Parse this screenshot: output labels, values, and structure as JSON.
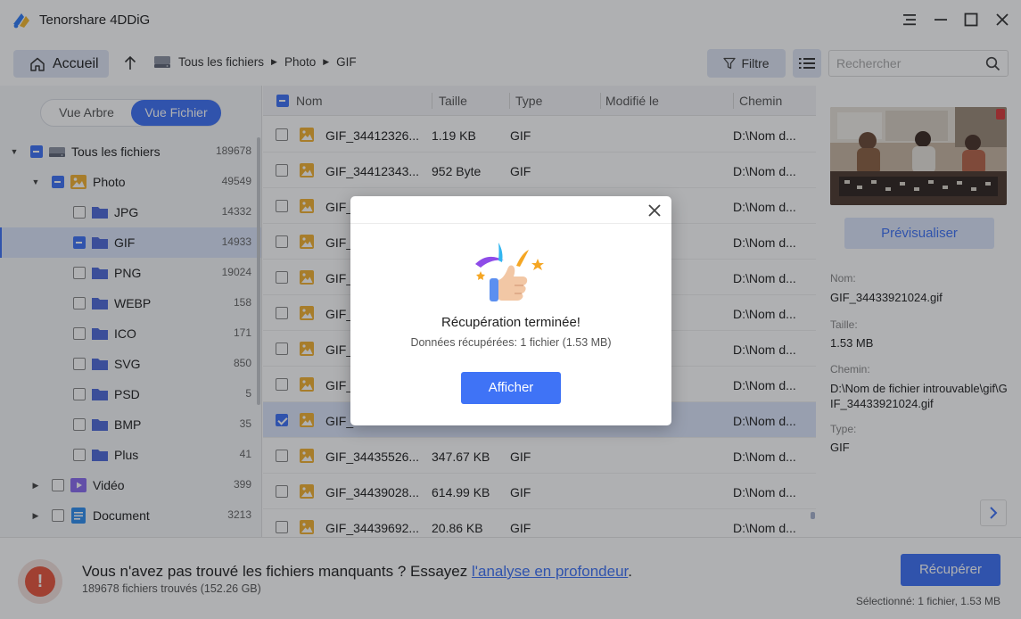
{
  "app": {
    "title": "Tenorshare 4DDiG"
  },
  "toolbar": {
    "home_label": "Accueil",
    "breadcrumb": [
      "Tous les fichiers",
      "Photo",
      "GIF"
    ],
    "filter_label": "Filtre",
    "search_placeholder": "Rechercher"
  },
  "sidebar": {
    "view_tree_label": "Vue Arbre",
    "view_file_label": "Vue Fichier",
    "tree": [
      {
        "label": "Tous les fichiers",
        "count": "189678"
      },
      {
        "label": "Photo",
        "count": "49549"
      },
      {
        "label": "JPG",
        "count": "14332"
      },
      {
        "label": "GIF",
        "count": "14933"
      },
      {
        "label": "PNG",
        "count": "19024"
      },
      {
        "label": "WEBP",
        "count": "158"
      },
      {
        "label": "ICO",
        "count": "171"
      },
      {
        "label": "SVG",
        "count": "850"
      },
      {
        "label": "PSD",
        "count": "5"
      },
      {
        "label": "BMP",
        "count": "35"
      },
      {
        "label": "Plus",
        "count": "41"
      },
      {
        "label": "Vidéo",
        "count": "399"
      },
      {
        "label": "Document",
        "count": "3213"
      }
    ]
  },
  "file_list": {
    "columns": [
      "Nom",
      "Taille",
      "Type",
      "Modifié le",
      "Chemin"
    ],
    "rows": [
      {
        "name": "GIF_34412326...",
        "size": "1.19 KB",
        "type": "GIF",
        "modified": "",
        "path": "D:\\Nom d..."
      },
      {
        "name": "GIF_34412343...",
        "size": "952 Byte",
        "type": "GIF",
        "modified": "",
        "path": "D:\\Nom d..."
      },
      {
        "name": "GIF_",
        "size": "",
        "type": "",
        "modified": "",
        "path": "D:\\Nom d..."
      },
      {
        "name": "GIF_",
        "size": "",
        "type": "",
        "modified": "",
        "path": "D:\\Nom d..."
      },
      {
        "name": "GIF_",
        "size": "",
        "type": "",
        "modified": "",
        "path": "D:\\Nom d..."
      },
      {
        "name": "GIF_",
        "size": "",
        "type": "",
        "modified": "",
        "path": "D:\\Nom d..."
      },
      {
        "name": "GIF_",
        "size": "",
        "type": "",
        "modified": "",
        "path": "D:\\Nom d..."
      },
      {
        "name": "GIF_",
        "size": "",
        "type": "",
        "modified": "",
        "path": "D:\\Nom d..."
      },
      {
        "name": "GIF_",
        "size": "",
        "type": "",
        "modified": "",
        "path": "D:\\Nom d..."
      },
      {
        "name": "GIF_34435526...",
        "size": "347.67 KB",
        "type": "GIF",
        "modified": "",
        "path": "D:\\Nom d..."
      },
      {
        "name": "GIF_34439028...",
        "size": "614.99 KB",
        "type": "GIF",
        "modified": "",
        "path": "D:\\Nom d..."
      },
      {
        "name": "GIF_34439692...",
        "size": "20.86 KB",
        "type": "GIF",
        "modified": "",
        "path": "D:\\Nom d..."
      }
    ]
  },
  "preview": {
    "button_label": "Prévisualiser",
    "name_label": "Nom:",
    "name_value": "GIF_34433921024.gif",
    "size_label": "Taille:",
    "size_value": "1.53 MB",
    "path_label": "Chemin:",
    "path_value": "D:\\Nom de fichier introuvable\\gif\\GIF_34433921024.gif",
    "type_label": "Type:",
    "type_value": "GIF"
  },
  "footer": {
    "message_prefix": "Vous n'avez pas trouvé les fichiers manquants ? Essayez ",
    "message_link": "l'analyse en profondeur",
    "message_suffix": ".",
    "found_text": "189678 fichiers trouvés (152.26 GB)",
    "recover_label": "Récupérer",
    "selected_text": "Sélectionné: 1 fichier, 1.53 MB"
  },
  "modal": {
    "title": "Récupération terminée!",
    "subtitle": "Données récupérées: 1 fichier (1.53 MB)",
    "button_label": "Afficher"
  },
  "colors": {
    "accent": "#3f73f6",
    "selected_row": "#dce6fb",
    "warning": "#e8553e"
  }
}
